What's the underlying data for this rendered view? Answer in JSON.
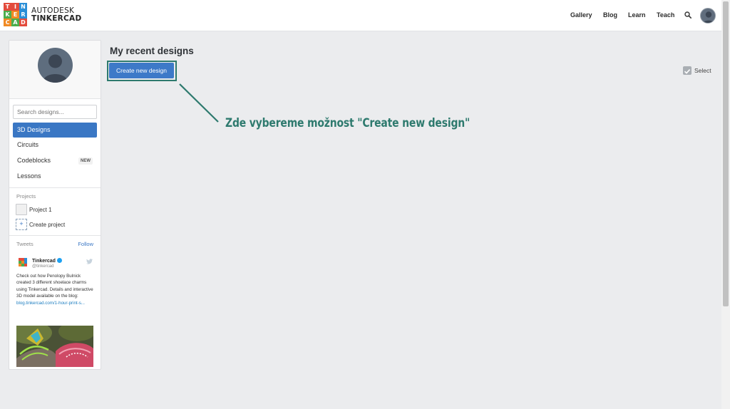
{
  "header": {
    "logo_letters": [
      "T",
      "I",
      "N",
      "K",
      "E",
      "R",
      "C",
      "A",
      "D"
    ],
    "logo_colors": [
      "#e34b3c",
      "#e34b3c",
      "#2a8ed6",
      "#4cae4c",
      "#f08a24",
      "#2a8ed6",
      "#f08a24",
      "#4cae4c",
      "#e34b3c"
    ],
    "brand_line1": "AUTODESK",
    "brand_line2": "TINKERCAD",
    "nav": [
      "Gallery",
      "Blog",
      "Learn",
      "Teach"
    ]
  },
  "sidebar": {
    "search_placeholder": "Search designs...",
    "items": [
      {
        "label": "3D Designs",
        "active": true
      },
      {
        "label": "Circuits"
      },
      {
        "label": "Codeblocks",
        "badge": "NEW"
      },
      {
        "label": "Lessons"
      }
    ],
    "projects_label": "Projects",
    "projects": [
      "Project 1"
    ],
    "create_project_label": "Create project",
    "tweets_label": "Tweets",
    "follow_label": "Follow",
    "tweet": {
      "author": "Tinkercad",
      "handle": "@tinkercad",
      "text": "Check out how Penolopy Bulnick created 3 different shoelace charms using Tinkercad. Details and interactive 3D model available on the blog: ",
      "link": "blog.tinkercad.com/1-hour-print-s..."
    }
  },
  "main": {
    "title": "My recent designs",
    "create_button": "Create new design",
    "select_label": "Select",
    "annotation": "Zde vybereme možnost \"Create new design\""
  },
  "colors": {
    "accent": "#3d79c8",
    "annotation": "#2e7a6e"
  }
}
